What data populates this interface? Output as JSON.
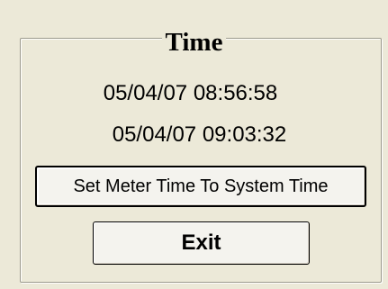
{
  "group": {
    "title": "Time"
  },
  "times": {
    "meter_time": "05/04/07 08:56:58",
    "system_time": "05/04/07 09:03:32"
  },
  "buttons": {
    "set_time_label": "Set Meter Time To System Time",
    "exit_label": "Exit"
  }
}
